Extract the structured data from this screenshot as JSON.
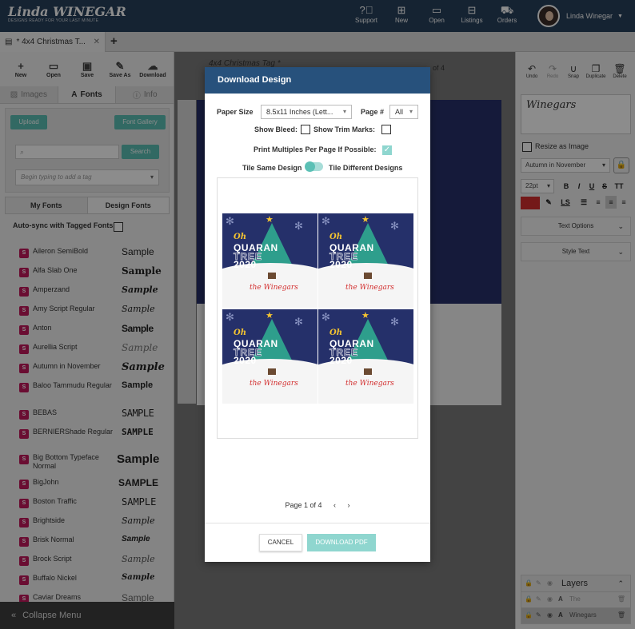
{
  "app": {
    "logo": "Linda WINEGAR",
    "logo_sub": "DESIGNS READY FOR YOUR LAST MINUTE"
  },
  "topnav": [
    {
      "label": "Support",
      "icon": "question-icon"
    },
    {
      "label": "New",
      "icon": "new-doc-icon"
    },
    {
      "label": "Open",
      "icon": "folder-icon"
    },
    {
      "label": "Listings",
      "icon": "gift-icon"
    },
    {
      "label": "Orders",
      "icon": "cart-icon"
    }
  ],
  "user": {
    "name": "Linda Winegar",
    "caret": "▼"
  },
  "doc_tab": {
    "title": "* 4x4 Christmas T...",
    "close": "✕",
    "plus": "+"
  },
  "left_toolbar": [
    {
      "label": "New",
      "glyph": "+"
    },
    {
      "label": "Open",
      "glyph": "▭"
    },
    {
      "label": "Save",
      "glyph": "▣"
    },
    {
      "label": "Save As",
      "glyph": "✎"
    },
    {
      "label": "Download",
      "glyph": "☁"
    }
  ],
  "panel_tabs": [
    {
      "label": "Images",
      "active": false
    },
    {
      "label": "Fonts",
      "active": true
    },
    {
      "label": "Info",
      "active": false
    }
  ],
  "fonts_panel": {
    "upload": "Upload",
    "font_gallery": "Font Gallery",
    "search_button": "Search",
    "search_placeholder": "",
    "tag_placeholder": "Begin typing to add a tag",
    "subtabs": [
      "My Fonts",
      "Design Fonts"
    ],
    "autosync": "Auto-sync with Tagged Fonts"
  },
  "font_list": [
    {
      "name": "Aileron SemiBold",
      "sample": "Sample"
    },
    {
      "name": "Alfa Slab One",
      "sample": "Sample"
    },
    {
      "name": "Amperzand",
      "sample": "Sample"
    },
    {
      "name": "Amy Script Regular",
      "sample": "Sample"
    },
    {
      "name": "Anton",
      "sample": "Sample"
    },
    {
      "name": "Aurellia Script",
      "sample": "Sample"
    },
    {
      "name": "Autumn in November",
      "sample": "Sample"
    },
    {
      "name": "Baloo Tammudu Regular",
      "sample": "Sample"
    },
    {
      "name": "BEBAS",
      "sample": "SAMPLE"
    },
    {
      "name": "BERNIERShade Regular",
      "sample": "SAMPLE"
    },
    {
      "name": "Big Bottom Typeface Normal",
      "sample": "Sample"
    },
    {
      "name": "BigJohn",
      "sample": "SAMPLE"
    },
    {
      "name": "Boston Traffic",
      "sample": "SAMPLE"
    },
    {
      "name": "Brightside",
      "sample": "Sample"
    },
    {
      "name": "Brisk Normal",
      "sample": "Sample"
    },
    {
      "name": "Brock Script",
      "sample": "Sample"
    },
    {
      "name": "Buffalo Nickel",
      "sample": "Sample"
    },
    {
      "name": "Caviar Dreams",
      "sample": "Sample"
    }
  ],
  "collapse_menu": "Collapse Menu",
  "canvas": {
    "tab_title": "4x4 Christmas Tag *",
    "page_of": "of 4"
  },
  "right_toolbar": [
    {
      "label": "Undo",
      "glyph": "↶"
    },
    {
      "label": "Redo",
      "glyph": "↷"
    },
    {
      "label": "Snap",
      "glyph": "∪"
    },
    {
      "label": "Duplicate",
      "glyph": "❐"
    },
    {
      "label": "Delete",
      "glyph": "🗑"
    }
  ],
  "text_panel": {
    "text_value": "Winegars",
    "resize_as_image": "Resize as Image",
    "font_select": "Autumn in November",
    "size_select": "22pt",
    "format": [
      "B",
      "I",
      "U",
      "S",
      "TT"
    ],
    "color": "#d32f2f",
    "text_options": "Text Options",
    "style_text": "Style Text"
  },
  "layers": {
    "title": "Layers",
    "rows": [
      {
        "label": "The"
      },
      {
        "label": "Winegars"
      }
    ]
  },
  "modal": {
    "title": "Download Design",
    "paper_size_label": "Paper Size",
    "paper_size_value": "8.5x11 Inches (Lett...",
    "page_label": "Page #",
    "page_value": "All",
    "show_bleed": "Show Bleed:",
    "show_trim": "Show Trim Marks:",
    "print_multiples": "Print Multiples Per Page If Possible:",
    "tile_same": "Tile Same Design",
    "tile_different": "Tile Different Designs",
    "pager": "Page 1 of 4",
    "cancel": "CANCEL",
    "download": "DOWNLOAD PDF"
  },
  "tile_art": {
    "oh": "Oh",
    "quaran": "QUARAN",
    "tree": "TREE",
    "year": "2020",
    "family": "the Winegars"
  }
}
